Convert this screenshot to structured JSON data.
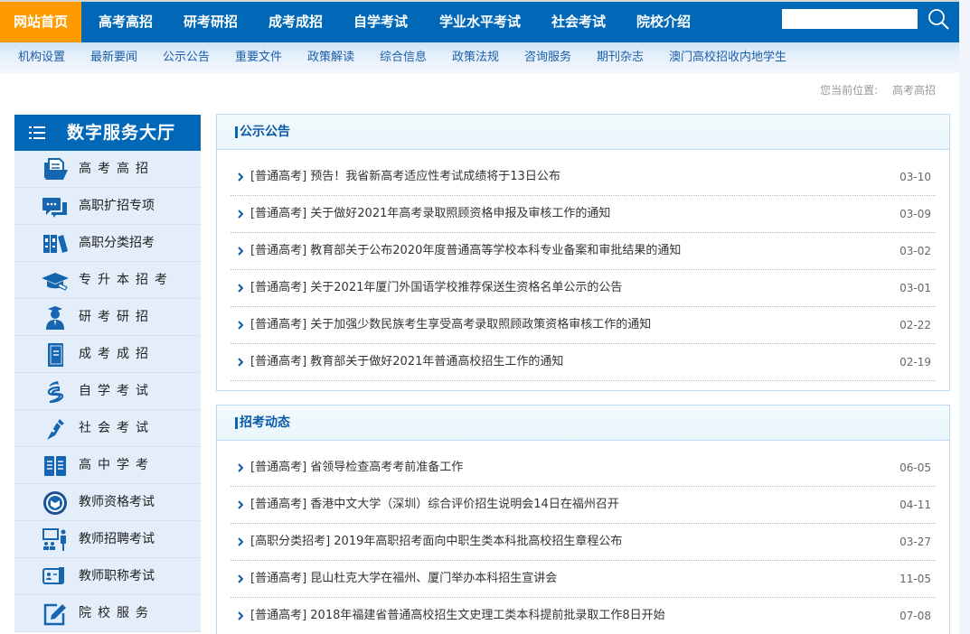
{
  "top_nav": {
    "items": [
      {
        "label": "网站首页",
        "active": true
      },
      {
        "label": "高考高招",
        "active": false
      },
      {
        "label": "研考研招",
        "active": false
      },
      {
        "label": "成考成招",
        "active": false
      },
      {
        "label": "自学考试",
        "active": false
      },
      {
        "label": "学业水平考试",
        "active": false
      },
      {
        "label": "社会考试",
        "active": false
      },
      {
        "label": "院校介绍",
        "active": false
      }
    ],
    "search": {
      "value": "",
      "placeholder": "",
      "icon": "search-icon"
    },
    "colors": {
      "bar": "#0068b7",
      "active": "#ff9a00"
    }
  },
  "sub_nav": {
    "items": [
      "机构设置",
      "最新要闻",
      "公示公告",
      "重要文件",
      "政策解读",
      "综合信息",
      "政策法规",
      "咨询服务",
      "期刊杂志",
      "澳门高校招收内地学生"
    ]
  },
  "breadcrumb": {
    "prefix": "您当前位置:",
    "current": "高考高招"
  },
  "sidebar": {
    "title": "数字服务大厅",
    "title_icon": "list-menu-icon",
    "items": [
      {
        "label": "高考高招",
        "icon": "folder-document-icon",
        "spaced": true
      },
      {
        "label": "高职扩招专项",
        "icon": "chat-bubbles-icon",
        "spaced": false
      },
      {
        "label": "高职分类招考",
        "icon": "binders-icon",
        "spaced": false
      },
      {
        "label": "专升本招考",
        "icon": "graduation-cap-icon",
        "spaced": true
      },
      {
        "label": "研考研招",
        "icon": "graduate-person-icon",
        "spaced": true
      },
      {
        "label": "成考成招",
        "icon": "book-icon",
        "spaced": true
      },
      {
        "label": "自学考试",
        "icon": "swirl-logo-icon",
        "spaced": true
      },
      {
        "label": "社会考试",
        "icon": "pen-nib-icon",
        "spaced": true
      },
      {
        "label": "高中学考",
        "icon": "open-book-icon",
        "spaced": true
      },
      {
        "label": "教师资格考试",
        "icon": "teacher-badge-icon",
        "spaced": false
      },
      {
        "label": "教师招聘考试",
        "icon": "teacher-presentation-icon",
        "spaced": false
      },
      {
        "label": "教师职称考试",
        "icon": "certificate-icon",
        "spaced": false
      },
      {
        "label": "院校服务",
        "icon": "edit-icon",
        "spaced": true
      }
    ]
  },
  "panels": [
    {
      "title": "公示公告",
      "items": [
        {
          "text": "[普通高考] 预告！我省新高考适应性考试成绩将于13日公布",
          "date": "03-10"
        },
        {
          "text": "[普通高考] 关于做好2021年高考录取照顾资格申报及审核工作的通知",
          "date": "03-09"
        },
        {
          "text": "[普通高考] 教育部关于公布2020年度普通高等学校本科专业备案和审批结果的通知",
          "date": "03-02"
        },
        {
          "text": "[普通高考] 关于2021年厦门外国语学校推荐保送生资格名单公示的公告",
          "date": "03-01"
        },
        {
          "text": "[普通高考] 关于加强少数民族考生享受高考录取照顾政策资格审核工作的通知",
          "date": "02-22"
        },
        {
          "text": "[普通高考] 教育部关于做好2021年普通高校招生工作的通知",
          "date": "02-19"
        }
      ]
    },
    {
      "title": "招考动态",
      "items": [
        {
          "text": "[普通高考] 省领导检查高考考前准备工作",
          "date": "06-05"
        },
        {
          "text": "[普通高考] 香港中文大学（深圳）综合评价招生说明会14日在福州召开",
          "date": "04-11"
        },
        {
          "text": "[高职分类招考] 2019年高职招考面向中职生类本科批高校招生章程公布",
          "date": "03-27"
        },
        {
          "text": "[普通高考] 昆山杜克大学在福州、厦门举办本科招生宣讲会",
          "date": "11-05"
        },
        {
          "text": "[普通高考] 2018年福建省普通高校招生文史理工类本科提前批录取工作8日开始",
          "date": "07-08"
        }
      ]
    }
  ]
}
